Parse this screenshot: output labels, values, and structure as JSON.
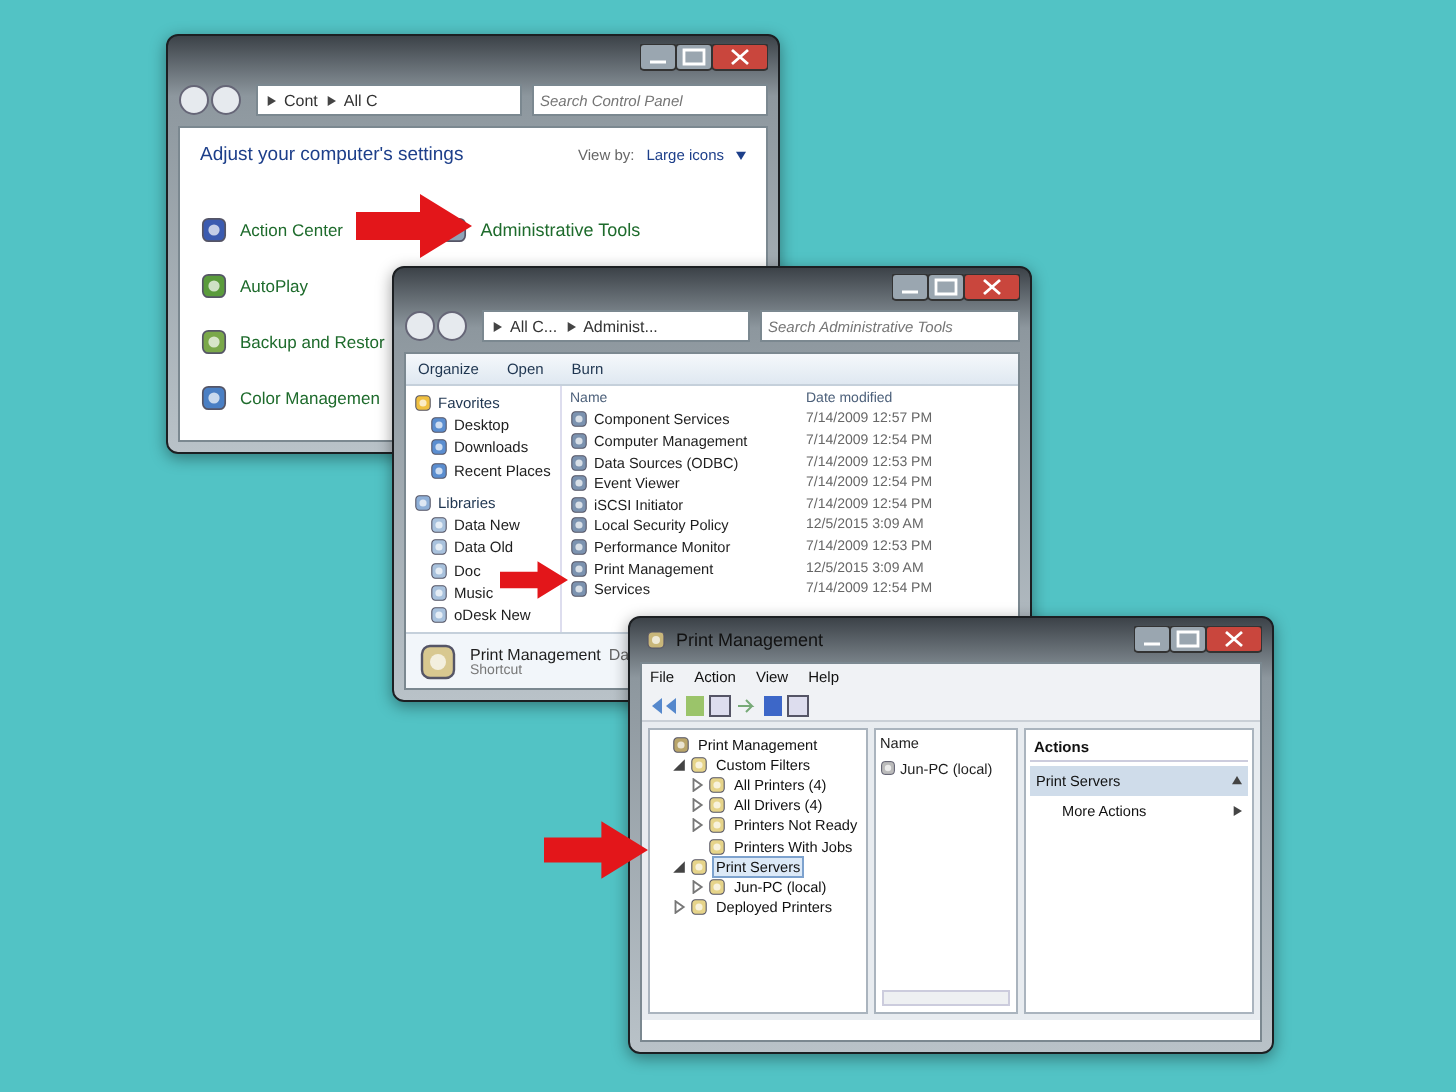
{
  "control_panel": {
    "address": [
      "Cont",
      "All C"
    ],
    "search": {
      "placeholder": "Search Control Panel"
    },
    "heading": "Adjust your computer's settings",
    "view_by": {
      "label": "View by:",
      "value": "Large icons"
    },
    "columns": [
      [
        "Action Center",
        "AutoPlay",
        "Backup and Restor",
        "Color Managemen"
      ],
      [
        "Administrative Tools"
      ]
    ]
  },
  "explorer": {
    "address": [
      "All C...",
      "Administ..."
    ],
    "search": {
      "placeholder": "Search Administrative Tools"
    },
    "toolbar": [
      "Organize",
      "Open",
      "Burn"
    ],
    "nav": [
      {
        "label": "Favorites",
        "children": [
          "Desktop",
          "Downloads",
          "Recent Places"
        ]
      },
      {
        "label": "Libraries",
        "children": [
          "Data New",
          "Data Old",
          "Doc",
          "Music",
          "oDesk New"
        ]
      }
    ],
    "columns": [
      "Name",
      "Date modified"
    ],
    "rows": [
      {
        "name": "Component Services",
        "date": "7/14/2009 12:57 PM"
      },
      {
        "name": "Computer Management",
        "date": "7/14/2009 12:54 PM"
      },
      {
        "name": "Data Sources (ODBC)",
        "date": "7/14/2009 12:53 PM"
      },
      {
        "name": "Event Viewer",
        "date": "7/14/2009 12:54 PM"
      },
      {
        "name": "iSCSI Initiator",
        "date": "7/14/2009 12:54 PM"
      },
      {
        "name": "Local Security Policy",
        "date": "12/5/2015 3:09 AM"
      },
      {
        "name": "Performance Monitor",
        "date": "7/14/2009 12:53 PM"
      },
      {
        "name": "Print Management",
        "date": "12/5/2015 3:09 AM"
      },
      {
        "name": "Services",
        "date": "7/14/2009 12:54 PM"
      }
    ],
    "details": {
      "title": "Print Management",
      "extra": "Da",
      "subtitle": "Shortcut"
    }
  },
  "print_management": {
    "title": "Print Management",
    "menu": [
      "File",
      "Action",
      "View",
      "Help"
    ],
    "tree": [
      {
        "label": "Print Management",
        "selected": false,
        "children": [
          {
            "label": "Custom Filters",
            "selected": false,
            "expanded": true,
            "children": [
              {
                "label": "All Printers (4)",
                "selected": false,
                "expanded": false
              },
              {
                "label": "All Drivers (4)",
                "selected": false,
                "expanded": false
              },
              {
                "label": "Printers Not Ready",
                "selected": false,
                "expanded": false
              },
              {
                "label": "Printers With Jobs",
                "selected": false
              }
            ]
          },
          {
            "label": "Print Servers",
            "selected": true,
            "expanded": true,
            "children": [
              {
                "label": "Jun-PC (local)",
                "selected": false,
                "expanded": false
              }
            ]
          },
          {
            "label": "Deployed Printers",
            "selected": false,
            "expanded": false
          }
        ]
      }
    ],
    "list": {
      "column": "Name",
      "rows": [
        "Jun-PC (local)"
      ]
    },
    "actions": {
      "title": "Actions",
      "sections": [
        {
          "title": "Print Servers",
          "items": [
            "More Actions"
          ]
        }
      ]
    }
  }
}
